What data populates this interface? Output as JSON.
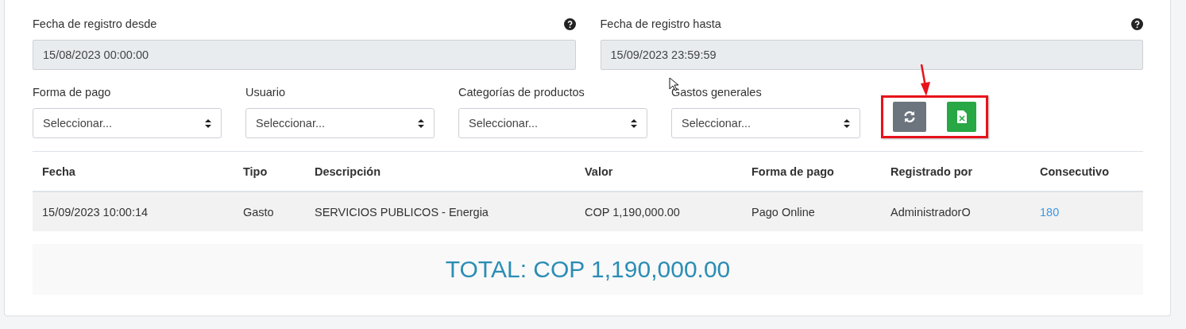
{
  "date_filters": [
    {
      "label": "Fecha de registro desde",
      "value": "15/08/2023 00:00:00"
    },
    {
      "label": "Fecha de registro hasta",
      "value": "15/09/2023 23:59:59"
    }
  ],
  "select_filters": [
    {
      "label": "Forma de pago",
      "value": "Seleccionar..."
    },
    {
      "label": "Usuario",
      "value": "Seleccionar..."
    },
    {
      "label": "Categorías de productos",
      "value": "Seleccionar..."
    },
    {
      "label": "Gastos generales",
      "value": "Seleccionar..."
    }
  ],
  "actions": [
    {
      "kind": "refresh"
    },
    {
      "kind": "excel"
    }
  ],
  "table": {
    "columns": [
      "Fecha",
      "Tipo",
      "Descripción",
      "Valor",
      "Forma de pago",
      "Registrado por",
      "Consecutivo"
    ],
    "rows": [
      {
        "cells": [
          {
            "text": "15/09/2023 10:00:14",
            "kind": "text"
          },
          {
            "text": "Gasto",
            "kind": "text"
          },
          {
            "text": "SERVICIOS PUBLICOS - Energia",
            "kind": "text"
          },
          {
            "text": "COP 1,190,000.00",
            "kind": "text"
          },
          {
            "text": "Pago Online",
            "kind": "text"
          },
          {
            "text": "AdministradorO",
            "kind": "text"
          },
          {
            "text": "180",
            "kind": "link"
          }
        ]
      }
    ]
  },
  "total": "TOTAL: COP 1,190,000.00"
}
